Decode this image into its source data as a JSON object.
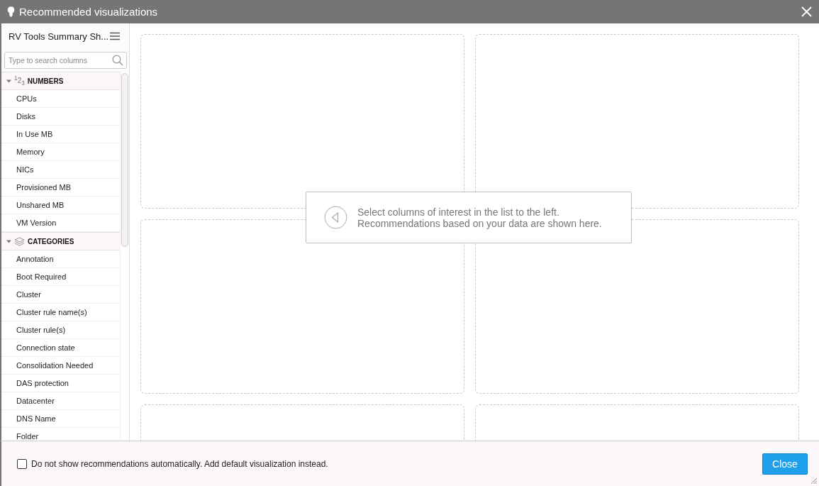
{
  "window": {
    "title": "Recommended visualizations"
  },
  "sidebar": {
    "source": "RV Tools Summary Sh...",
    "search": {
      "placeholder": "Type to search columns"
    },
    "groups": [
      {
        "kind": "numbers",
        "badge": "$^{1}$2$_{3}$",
        "label": "NUMBERS",
        "expanded": true,
        "items": [
          "CPUs",
          "Disks",
          "In Use MB",
          "Memory",
          "NICs",
          "Provisioned MB",
          "Unshared MB",
          "VM Version"
        ]
      },
      {
        "kind": "categories",
        "label": "CATEGORIES",
        "expanded": true,
        "items": [
          "Annotation",
          "Boot Required",
          "Cluster",
          "Cluster rule name(s)",
          "Cluster rule(s)",
          "Connection state",
          "Consolidation Needed",
          "DAS protection",
          "Datacenter",
          "DNS Name",
          "Folder"
        ]
      }
    ]
  },
  "hint": {
    "lines": [
      "Select columns of interest in the list to the left.",
      "Recommendations based on your data are shown here."
    ]
  },
  "footer": {
    "checkbox": {
      "label": "Do not show recommendations automatically. Add default visualization instead.",
      "checked": false
    },
    "button": "Close"
  }
}
